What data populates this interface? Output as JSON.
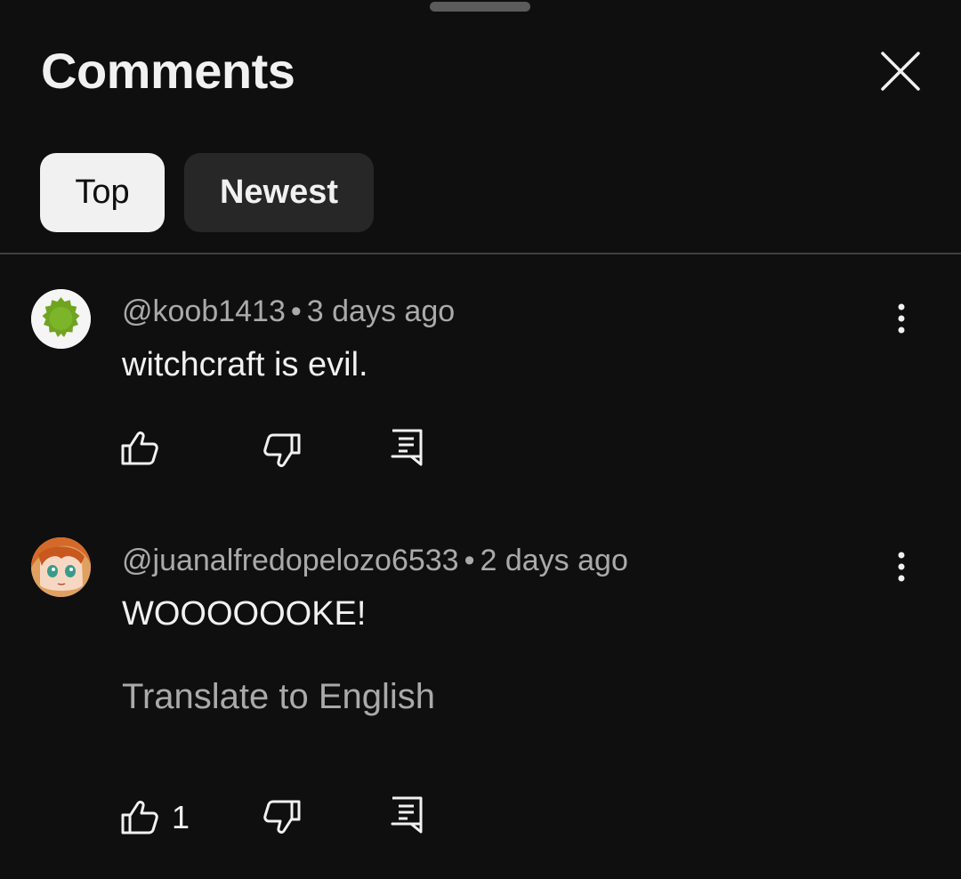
{
  "panel": {
    "title": "Comments"
  },
  "sort": {
    "options": [
      {
        "label": "Top",
        "selected": true
      },
      {
        "label": "Newest",
        "selected": false
      }
    ]
  },
  "comments": [
    {
      "author": "@koob1413",
      "time": "3 days ago",
      "text": "witchcraft is evil.",
      "translate": "",
      "likes": ""
    },
    {
      "author": "@juanalfredopelozo6533",
      "time": "2 days ago",
      "text": "WOOOOOOKE!",
      "translate": "Translate to English",
      "likes": "1"
    }
  ],
  "separator": "•",
  "icons": {
    "close": "close-icon",
    "more": "more-vert-icon",
    "like": "thumbs-up-icon",
    "dislike": "thumbs-down-icon",
    "reply": "reply-icon"
  },
  "colors": {
    "background": "#0f0f0f",
    "text_primary": "#f1f1f1",
    "text_secondary": "#aaaaaa",
    "chip_selected_bg": "#f1f1f1",
    "chip_unselected_bg": "#272727",
    "avatar1": "#6fa420"
  }
}
